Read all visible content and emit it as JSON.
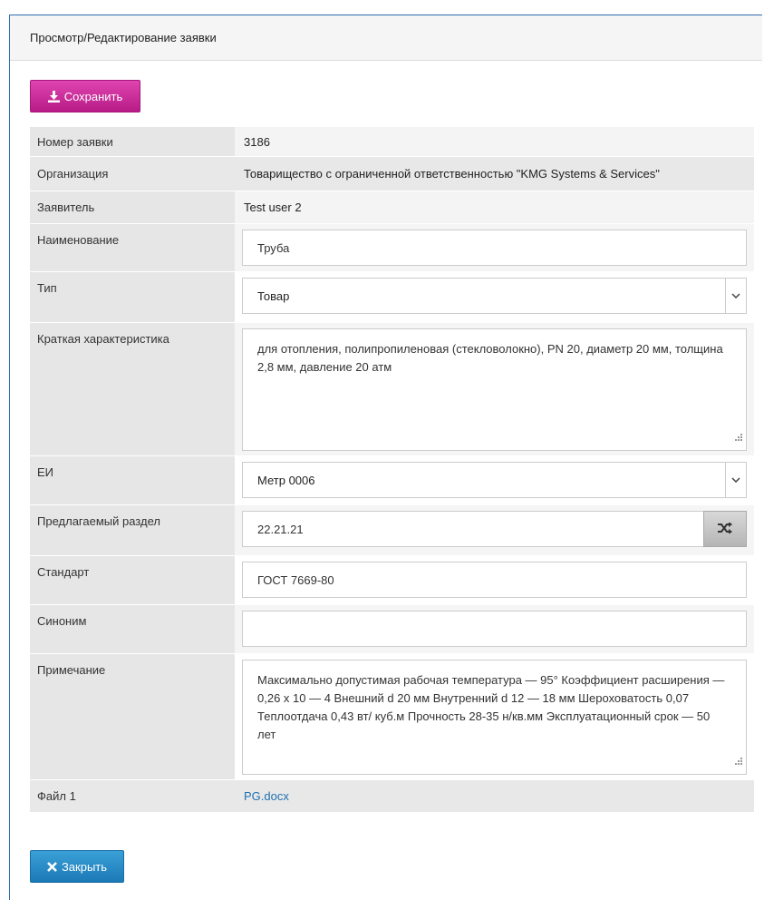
{
  "header": {
    "title": "Просмотр/Редактирование заявки"
  },
  "toolbar": {
    "save_label": "Сохранить",
    "save_icon": "download-icon"
  },
  "form": {
    "number_label": "Номер заявки",
    "number_value": "3186",
    "org_label": "Организация",
    "org_value": "Товарищество с ограниченной ответственностью \"KMG Systems & Services\"",
    "applicant_label": "Заявитель",
    "applicant_value": "Test user 2",
    "name_label": "Наименование",
    "name_value": "Труба",
    "type_label": "Тип",
    "type_value": "Товар",
    "desc_label": "Краткая характеристика",
    "desc_value": "для отопления, полипропиленовая (стекловолокно), PN 20, диаметр 20 мм, толщина 2,8 мм, давление 20 атм",
    "unit_label": "ЕИ",
    "unit_value": "Метр 0006",
    "section_label": "Предлагаемый раздел",
    "section_value": "22.21.21",
    "standard_label": "Стандарт",
    "standard_value": "ГОСТ 7669-80",
    "synonym_label": "Синоним",
    "synonym_value": "",
    "note_label": "Примечание",
    "note_value": "Максимально допустимая рабочая температура — 95° Коэффициент расширения — 0,26 х 10 — 4 Внешний d 20 мм Внутренний d 12 — 18 мм Шероховатость 0,07 Теплоотдача 0,43 вт/ куб.м Прочность 28-35 н/кв.мм Эксплуатационный срок — 50 лет",
    "file_label": "Файл 1",
    "file_value": "PG.docx"
  },
  "footer": {
    "close_label": "Закрыть",
    "close_icon": "close-icon"
  },
  "colors": {
    "save_button": "#c8269a",
    "close_button": "#2a8cc7",
    "panel_border": "#2f6fb0",
    "link": "#1f6fb0"
  }
}
